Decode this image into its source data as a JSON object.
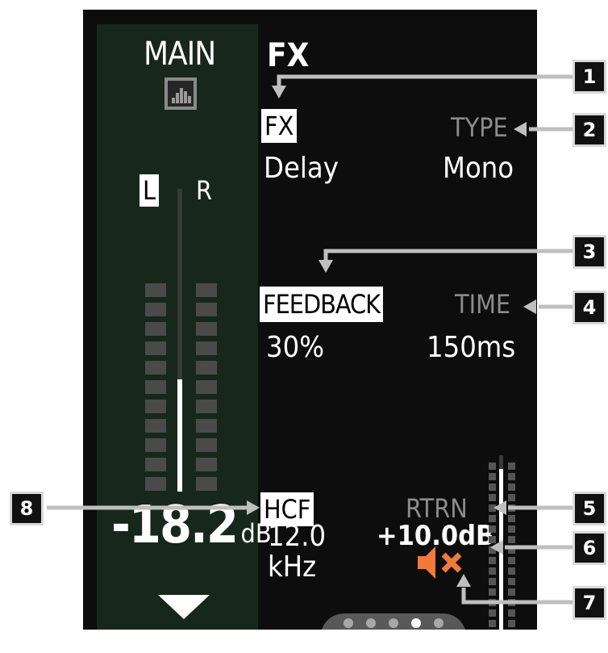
{
  "header": {
    "main_label": "MAIN",
    "page_title": "FX"
  },
  "fx": {
    "label": "FX",
    "value": "Delay"
  },
  "type": {
    "label": "TYPE",
    "value": "Mono"
  },
  "feedback": {
    "label": "FEEDBACK",
    "value": "30%"
  },
  "time": {
    "label": "TIME",
    "value": "150ms"
  },
  "hcf": {
    "label": "HCF",
    "value_number": "12.0",
    "value_unit": "kHz"
  },
  "rtrn": {
    "label": "RTRN",
    "value": "+10.0dB"
  },
  "level": {
    "value": "-18.2",
    "unit": "dB"
  },
  "meter": {
    "left_label": "L",
    "right_label": "R",
    "fader_position": 0.37
  },
  "rtrn_meter": {
    "fader_position": 0.92
  },
  "page_dots": {
    "count": 5,
    "active_index": 3
  },
  "callouts": [
    "1",
    "2",
    "3",
    "4",
    "5",
    "6",
    "7",
    "8"
  ],
  "colors": {
    "mute_icon": "#f07a3a",
    "main_strip": "#17271c",
    "callout_line": "#bfbfbf"
  },
  "icons": {
    "main_mix": "mix-bars-icon",
    "scroll": "down-arrow-icon",
    "mute": "speaker-mute-icon"
  }
}
